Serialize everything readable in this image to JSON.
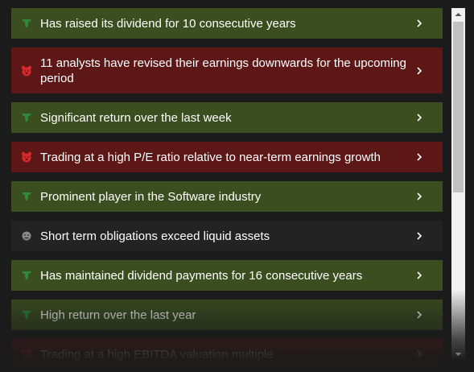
{
  "colors": {
    "bull": "#3a4e1f",
    "bear": "#5e1717",
    "neutral": "#232323",
    "bull_icon": "#2e8a3a",
    "bear_icon": "#d9292a",
    "neutral_icon": "#8a8a8a"
  },
  "items": [
    {
      "type": "bull",
      "icon": "bull-icon",
      "label": "Has raised its dividend for 10 consecutive years"
    },
    {
      "type": "bear",
      "icon": "bear-icon",
      "label": "11 analysts have revised their earnings downwards for the upcoming period"
    },
    {
      "type": "bull",
      "icon": "bull-icon",
      "label": "Significant return over the last week"
    },
    {
      "type": "bear",
      "icon": "bear-icon",
      "label": "Trading at a high P/E ratio relative to near-term earnings growth"
    },
    {
      "type": "bull",
      "icon": "bull-icon",
      "label": "Prominent player in the Software industry"
    },
    {
      "type": "neutral",
      "icon": "neutral-icon",
      "label": "Short term obligations exceed liquid assets"
    },
    {
      "type": "bull",
      "icon": "bull-icon",
      "label": "Has maintained dividend payments for 16 consecutive years"
    },
    {
      "type": "bull",
      "icon": "bull-icon",
      "label": "High return over the last year"
    },
    {
      "type": "bear",
      "icon": "bear-icon",
      "label": "Trading at a high EBITDA valuation multiple"
    }
  ]
}
